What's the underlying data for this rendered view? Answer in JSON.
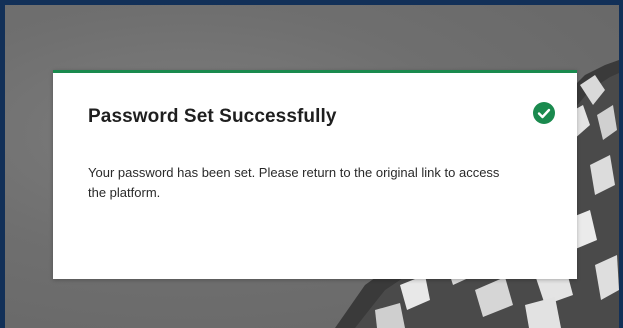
{
  "dialog": {
    "title": "Password Set Successfully",
    "message": "Your password has been set. Please return to the original link to access the platform.",
    "status_icon": "check-circle-icon",
    "accent_color": "#1a8a4e"
  },
  "background": {
    "frame_color": "#123058",
    "image": "snowy-mountain-photo"
  }
}
